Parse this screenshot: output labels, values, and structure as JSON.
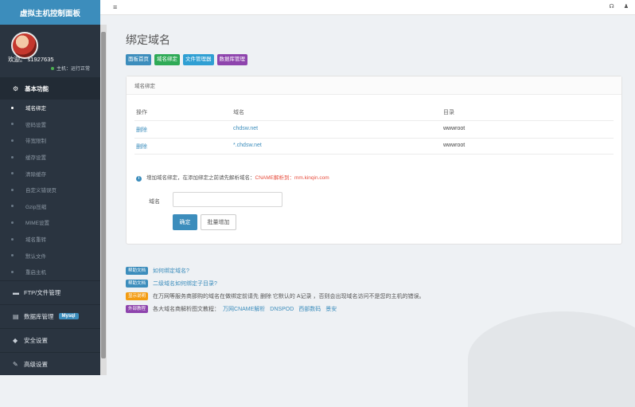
{
  "app": {
    "title": "虚拟主机控制面板"
  },
  "user": {
    "welcome": "欢迎。 s1927635",
    "status": "主机：运行正常"
  },
  "sidebar": {
    "section_basic": "基本功能",
    "sub_items": [
      "域名绑定",
      "密码设置",
      "带宽限制",
      "缓存设置",
      "清除缓存",
      "自定义错误页",
      "Gzip压缩",
      "MIME设置",
      "域名重转",
      "默认文件",
      "重启主机"
    ],
    "ftp": "FTP/文件管理",
    "db": "数据库管理",
    "db_badge": "Mysql",
    "security": "安全设置",
    "advanced": "高级设置"
  },
  "page": {
    "title": "绑定域名"
  },
  "tabs": [
    {
      "label": "面板首页",
      "color": "#3c8dbc"
    },
    {
      "label": "域名绑定",
      "color": "#2eaa56"
    },
    {
      "label": "文件管理器",
      "color": "#2f9fd3"
    },
    {
      "label": "数据库管理",
      "color": "#8e44ad"
    }
  ],
  "panel": {
    "heading": "域名绑定",
    "columns": [
      "操作",
      "域名",
      "目录"
    ],
    "rows": [
      {
        "action": "删除",
        "domain": "chdsw.net",
        "dir": "wwwroot"
      },
      {
        "action": "删除",
        "domain": "*.chdsw.net",
        "dir": "wwwroot"
      }
    ],
    "note_prefix": "增加域名绑定，在添加绑定之前请先解析域名：",
    "note_highlight": "CNAME解析到：mm.kinqin.com",
    "field_label": "域名",
    "field_value": "",
    "ok_label": "确定",
    "batch_label": "批量增加"
  },
  "help": [
    {
      "tag": "帮助文档",
      "tag_color": "#3c8dbc",
      "text": "",
      "link": "如何绑定域名?"
    },
    {
      "tag": "帮助文档",
      "tag_color": "#3c8dbc",
      "text": "",
      "link": "二级域名如何绑定子目录?"
    },
    {
      "tag": "显示说明",
      "tag_color": "#f39c12",
      "text": "在万网等服务商那购的域名在做绑定前请先 删除 它默认的 A记录 ，否则会出现域名访问不是您的主机的错误。",
      "link": ""
    },
    {
      "tag": "外部教程",
      "tag_color": "#8e44ad",
      "text": "各大域名商解析图文教程：",
      "links": [
        "万网CNAME解析",
        "DNSPOD",
        "西部数码",
        "景安"
      ]
    }
  ]
}
